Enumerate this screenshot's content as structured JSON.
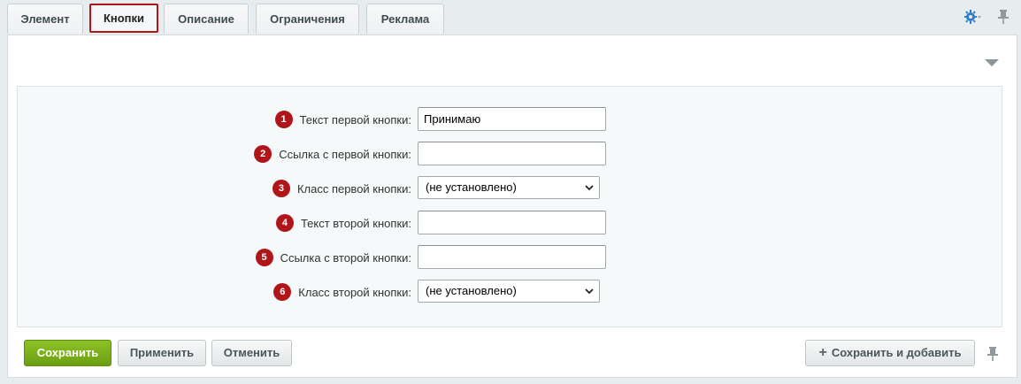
{
  "tabs": [
    {
      "label": "Элемент"
    },
    {
      "label": "Кнопки"
    },
    {
      "label": "Описание"
    },
    {
      "label": "Ограничения"
    },
    {
      "label": "Реклама"
    }
  ],
  "active_tab": "Кнопки",
  "icons": {
    "settings": "gear-icon",
    "pin": "pin-icon",
    "collapse": "triangle-down-icon"
  },
  "form": {
    "fields": [
      {
        "num": "1",
        "label": "Текст первой кнопки:",
        "type": "text",
        "value": "Принимаю"
      },
      {
        "num": "2",
        "label": "Ссылка с первой кнопки:",
        "type": "text",
        "value": ""
      },
      {
        "num": "3",
        "label": "Класс первой кнопки:",
        "type": "select",
        "value": "(не установлено)"
      },
      {
        "num": "4",
        "label": "Текст второй кнопки:",
        "type": "text",
        "value": ""
      },
      {
        "num": "5",
        "label": "Ссылка с второй кнопки:",
        "type": "text",
        "value": ""
      },
      {
        "num": "6",
        "label": "Класс второй кнопки:",
        "type": "select",
        "value": "(не установлено)"
      }
    ]
  },
  "buttons": {
    "save": "Сохранить",
    "apply": "Применить",
    "cancel": "Отменить",
    "save_and_add": "Сохранить и добавить"
  },
  "colors": {
    "accent_red": "#b0151a",
    "save_green": "#7bb01c",
    "gear_blue": "#2f7fc8"
  }
}
